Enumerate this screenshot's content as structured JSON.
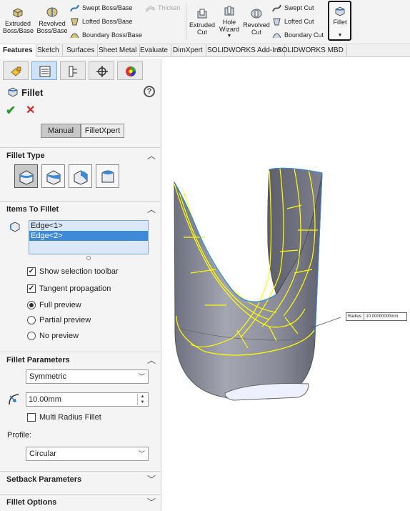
{
  "ribbon": {
    "extruded_boss": "Extruded Boss/Base",
    "revolved_boss": "Revolved Boss/Base",
    "swept_boss": "Swept Boss/Base",
    "lofted_boss": "Lofted Boss/Base",
    "boundary_boss": "Boundary Boss/Base",
    "thicken": "Thicken",
    "extruded_cut": "Extruded Cut",
    "hole_wizard": "Hole Wizard",
    "revolved_cut": "Revolved Cut",
    "swept_cut": "Swept Cut",
    "lofted_cut": "Lofted Cut",
    "boundary_cut": "Boundary Cut",
    "fillet": "Fillet"
  },
  "tabs": [
    "Features",
    "Sketch",
    "Surfaces",
    "Sheet Metal",
    "Evaluate",
    "DimXpert",
    "SOLIDWORKS Add-Ins",
    "SOLIDWORKS MBD"
  ],
  "pm": {
    "title": "Fillet",
    "help": "?",
    "ok": "✔",
    "cancel": "✕",
    "mode_manual": "Manual",
    "mode_xpert": "FilletXpert",
    "fillet_type_header": "Fillet Type",
    "items_header": "Items To Fillet",
    "edges": [
      "Edge<1>",
      "Edge<2>"
    ],
    "show_selection_toolbar": "Show selection toolbar",
    "tangent_propagation": "Tangent propagation",
    "full_preview": "Full preview",
    "partial_preview": "Partial preview",
    "no_preview": "No preview",
    "params_header": "Fillet Parameters",
    "symmetric": "Symmetric",
    "radius": "10.00mm",
    "multi_radius": "Multi Radius Fillet",
    "profile_label": "Profile:",
    "profile_value": "Circular",
    "setback_header": "Setback Parameters",
    "options_header": "Fillet Options"
  },
  "callout": {
    "label": "Radius:",
    "value": "10.00000000mm"
  },
  "colors": {
    "accent_blue": "#3d8ad8",
    "edge_yellow": "#ffff00",
    "part_gray": "#8e909c",
    "ok_green": "#2e9a2e",
    "cancel_red": "#d12a2a"
  }
}
